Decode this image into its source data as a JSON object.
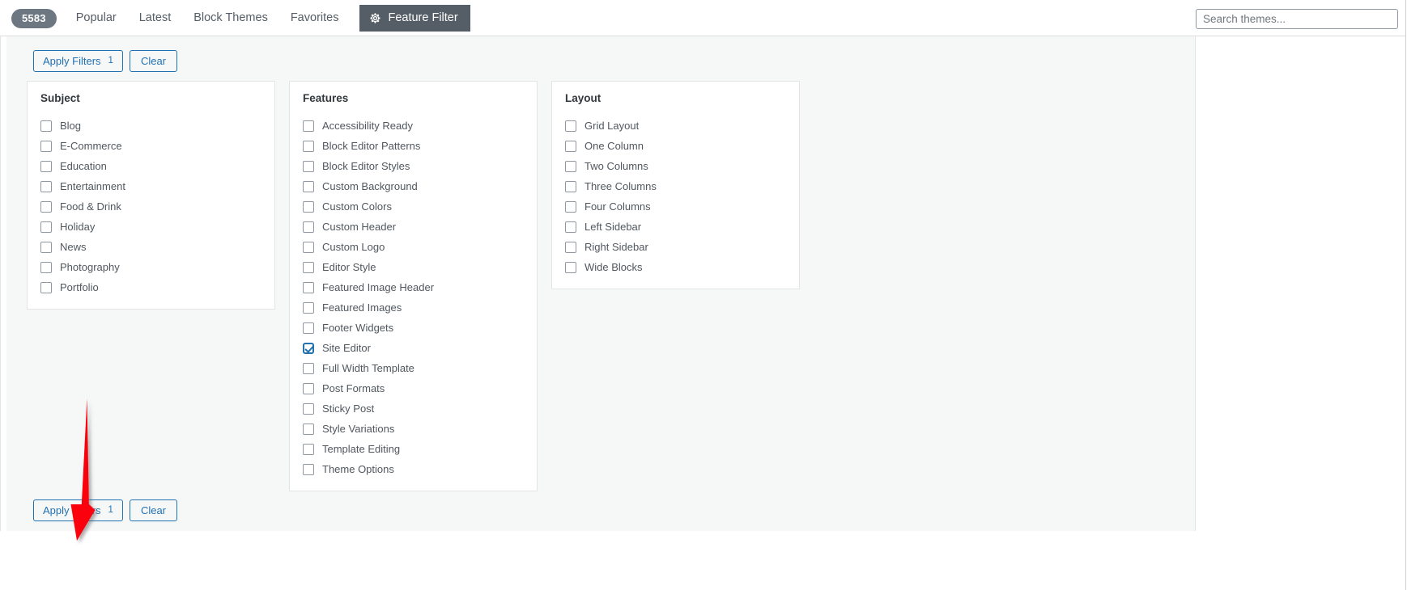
{
  "header": {
    "count_badge": "5583",
    "nav_items": [
      {
        "label": "Popular",
        "active": true
      },
      {
        "label": "Latest",
        "active": false
      },
      {
        "label": "Block Themes",
        "active": false
      },
      {
        "label": "Favorites",
        "active": false
      }
    ],
    "feature_filter_label": "Feature Filter",
    "feature_filter_icon": "gear-icon",
    "feature_filter_bg": "#555d66"
  },
  "search": {
    "placeholder": "Search themes...",
    "value": ""
  },
  "toolbar": {
    "apply_label": "Apply Filters",
    "apply_count": "1",
    "clear_label": "Clear",
    "accent_color": "#2271b1"
  },
  "groups": [
    {
      "title": "Subject",
      "options": [
        {
          "label": "Blog",
          "checked": false
        },
        {
          "label": "E-Commerce",
          "checked": false
        },
        {
          "label": "Education",
          "checked": false
        },
        {
          "label": "Entertainment",
          "checked": false
        },
        {
          "label": "Food & Drink",
          "checked": false
        },
        {
          "label": "Holiday",
          "checked": false
        },
        {
          "label": "News",
          "checked": false
        },
        {
          "label": "Photography",
          "checked": false
        },
        {
          "label": "Portfolio",
          "checked": false
        }
      ]
    },
    {
      "title": "Features",
      "options": [
        {
          "label": "Accessibility Ready",
          "checked": false
        },
        {
          "label": "Block Editor Patterns",
          "checked": false
        },
        {
          "label": "Block Editor Styles",
          "checked": false
        },
        {
          "label": "Custom Background",
          "checked": false
        },
        {
          "label": "Custom Colors",
          "checked": false
        },
        {
          "label": "Custom Header",
          "checked": false
        },
        {
          "label": "Custom Logo",
          "checked": false
        },
        {
          "label": "Editor Style",
          "checked": false
        },
        {
          "label": "Featured Image Header",
          "checked": false
        },
        {
          "label": "Featured Images",
          "checked": false
        },
        {
          "label": "Footer Widgets",
          "checked": false
        },
        {
          "label": "Site Editor",
          "checked": true
        },
        {
          "label": "Full Width Template",
          "checked": false
        },
        {
          "label": "Post Formats",
          "checked": false
        },
        {
          "label": "Sticky Post",
          "checked": false
        },
        {
          "label": "Style Variations",
          "checked": false
        },
        {
          "label": "Template Editing",
          "checked": false
        },
        {
          "label": "Theme Options",
          "checked": false
        }
      ]
    },
    {
      "title": "Layout",
      "options": [
        {
          "label": "Grid Layout",
          "checked": false
        },
        {
          "label": "One Column",
          "checked": false
        },
        {
          "label": "Two Columns",
          "checked": false
        },
        {
          "label": "Three Columns",
          "checked": false
        },
        {
          "label": "Four Columns",
          "checked": false
        },
        {
          "label": "Left Sidebar",
          "checked": false
        },
        {
          "label": "Right Sidebar",
          "checked": false
        },
        {
          "label": "Wide Blocks",
          "checked": false
        }
      ]
    }
  ],
  "annotation": {
    "type": "arrow",
    "direction": "down",
    "color": "#fb0007",
    "points_to": "apply-filters-button-bottom"
  }
}
